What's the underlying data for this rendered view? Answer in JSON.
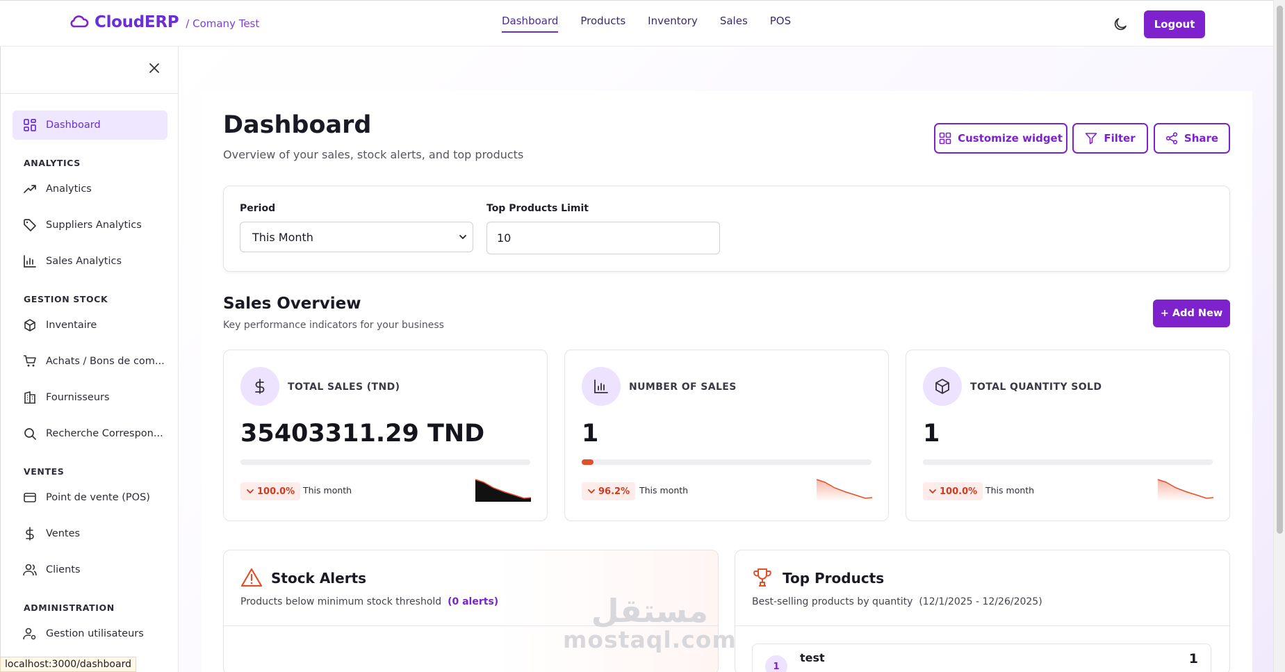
{
  "header": {
    "brand_name": "CloudERP",
    "company": "/ Comany Test",
    "nav": [
      "Dashboard",
      "Products",
      "Inventory",
      "Sales",
      "POS"
    ],
    "active_nav": "Dashboard",
    "logout_label": "Logout"
  },
  "sidebar": {
    "items": {
      "dashboard": "Dashboard",
      "analytics": "Analytics",
      "suppliers_analytics": "Suppliers Analytics",
      "sales_analytics": "Sales Analytics",
      "inventaire": "Inventaire",
      "achats": "Achats / Bons de com...",
      "fournisseurs": "Fournisseurs",
      "recherche": "Recherche Correspon...",
      "pos": "Point de vente (POS)",
      "ventes": "Ventes",
      "clients": "Clients",
      "utilisateurs": "Gestion utilisateurs"
    },
    "sections": {
      "analytics": "ANALYTICS",
      "stock": "GESTION STOCK",
      "ventes": "VENTES",
      "admin": "ADMINISTRATION"
    }
  },
  "status_url": "localhost:3000/dashboard",
  "page": {
    "title": "Dashboard",
    "subtitle": "Overview of your sales, stock alerts, and top products",
    "customize_label": "Customize widget",
    "filter_label": "Filter",
    "share_label": "Share"
  },
  "filters": {
    "period_label": "Period",
    "period_value": "This Month",
    "limit_label": "Top Products Limit",
    "limit_value": "10"
  },
  "sales_overview": {
    "title": "Sales Overview",
    "subtitle": "Key performance indicators for your business",
    "add_new_label": "+ Add New"
  },
  "kpis": [
    {
      "label": "TOTAL SALES (TND)",
      "value": "35403311.29 TND",
      "change": "100.0%",
      "period": "This month",
      "progress": 0,
      "icon": "dollar-icon"
    },
    {
      "label": "NUMBER OF SALES",
      "value": "1",
      "change": "96.2%",
      "period": "This month",
      "progress": 0.04,
      "icon": "bar-chart-icon"
    },
    {
      "label": "TOTAL QUANTITY SOLD",
      "value": "1",
      "change": "100.0%",
      "period": "This month",
      "progress": 0,
      "icon": "box-icon"
    }
  ],
  "stock_alerts": {
    "title": "Stock Alerts",
    "subtitle": "Products below minimum stock threshold",
    "count": "(0 alerts)"
  },
  "top_products": {
    "title": "Top Products",
    "subtitle": "Best-selling products by quantity",
    "range": "(12/1/2025 - 12/26/2025)",
    "items": [
      {
        "rank": "1",
        "name": "test",
        "quantity": "1"
      }
    ]
  },
  "watermark": {
    "arabic": "مستقل",
    "latin": "mostaql.com"
  },
  "colors": {
    "accent": "#7e22ce",
    "brand": "#6b2fd6",
    "negative": "#d03a1e"
  }
}
